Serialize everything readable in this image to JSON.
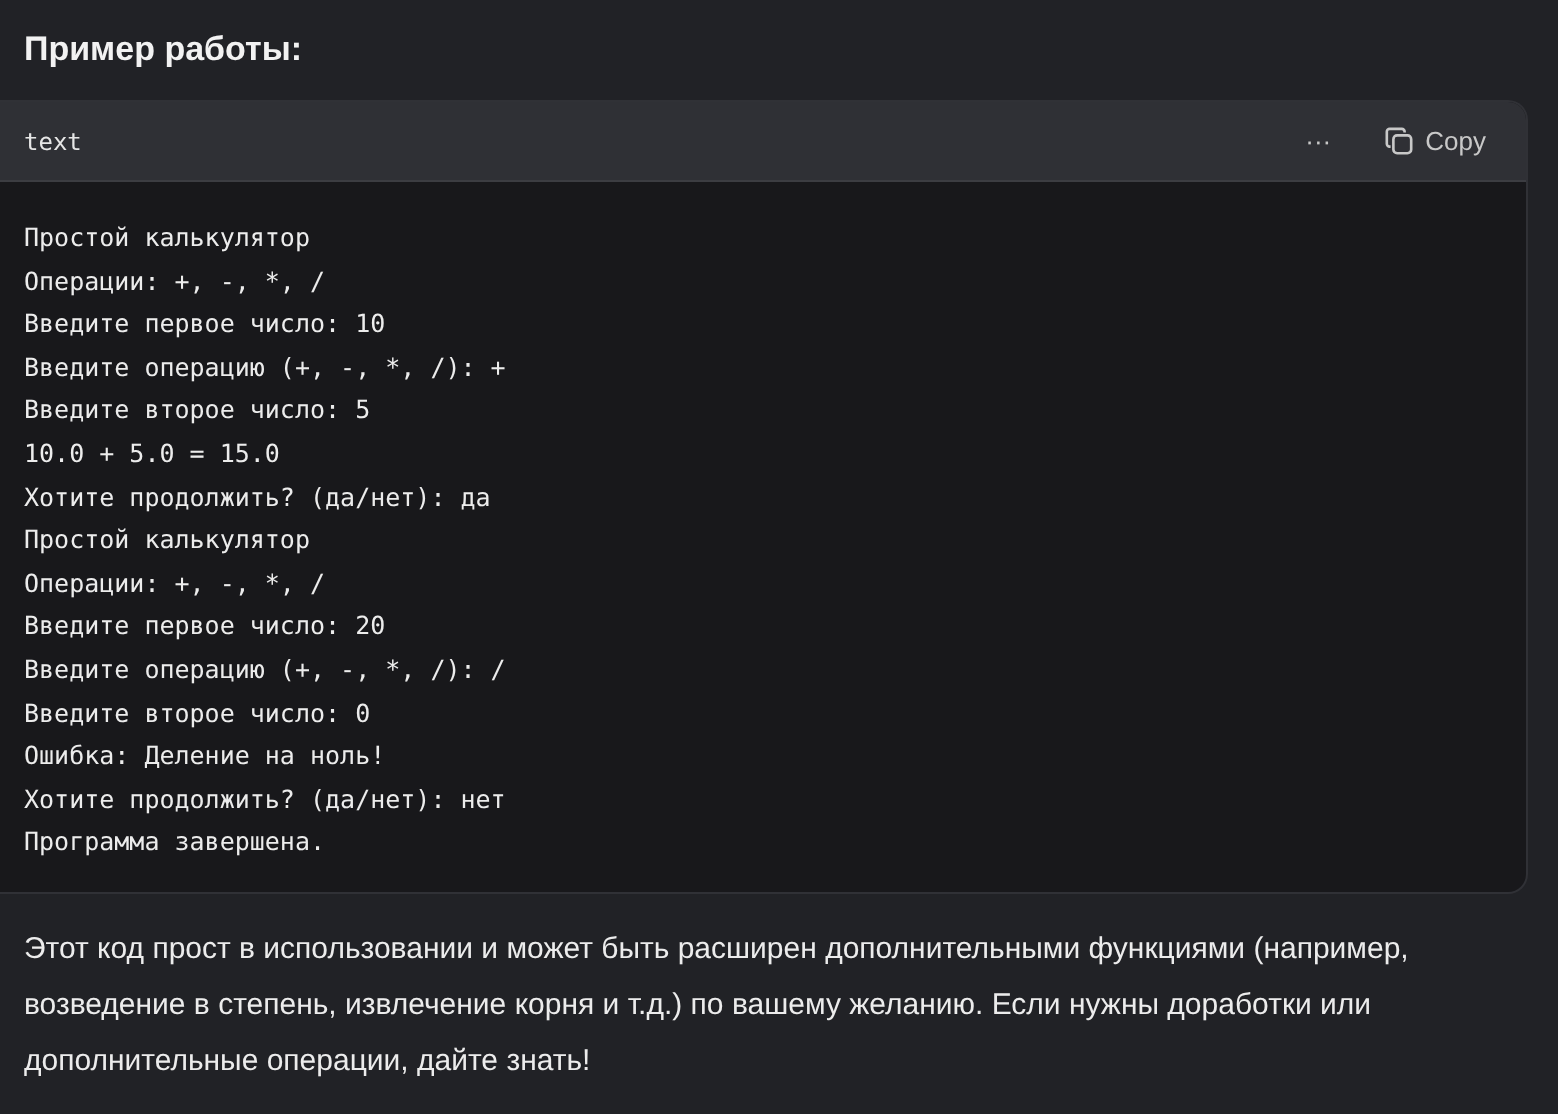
{
  "heading": "Пример работы:",
  "code_block": {
    "language": "text",
    "more_button": "···",
    "copy_button": "Copy",
    "lines": [
      "Простой калькулятор",
      "Операции: +, -, *, /",
      "Введите первое число: 10",
      "Введите операцию (+, -, *, /): +",
      "Введите второе число: 5",
      "10.0 + 5.0 = 15.0",
      "Хотите продолжить? (да/нет): да",
      "Простой калькулятор",
      "Операции: +, -, *, /",
      "Введите первое число: 20",
      "Введите операцию (+, -, *, /): /",
      "Введите второе число: 0",
      "Ошибка: Деление на ноль!",
      "Хотите продолжить? (да/нет): нет",
      "Программа завершена."
    ]
  },
  "paragraph": "Этот код прост в использовании и может быть расширен дополнительными функциями (например, возведение в степень, извлечение корня и т.д.) по вашему желанию. Если нужны доработки или дополнительные операции, дайте знать!"
}
